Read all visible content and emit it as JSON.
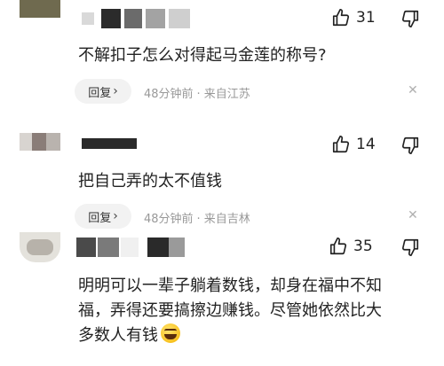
{
  "comments": [
    {
      "likes": "31",
      "text": "不解扣子怎么对得起马金莲的称号?",
      "reply_label": "回复",
      "time": "48分钟前",
      "location": "来自江苏",
      "separator": "·"
    },
    {
      "likes": "14",
      "text": "把自己弄的太不值钱",
      "reply_label": "回复",
      "time": "48分钟前",
      "location": "来自吉林",
      "separator": "·"
    },
    {
      "likes": "35",
      "text_lines": [
        "明明可以一辈子躺着数钱，却身在福中不知",
        "福，弄得还要搞擦边赚钱。尽管她依然比大",
        "多数人有钱"
      ]
    }
  ],
  "icons": {
    "like": "thumbs-up-icon",
    "dislike": "thumbs-down-icon",
    "close": "close-icon",
    "chevron": "chevron-right-icon",
    "emoji": "laughing-crying-emoji-icon"
  },
  "colors": {
    "meta_text": "#999999",
    "reply_bg": "#f2f2f2",
    "text": "#222222"
  }
}
